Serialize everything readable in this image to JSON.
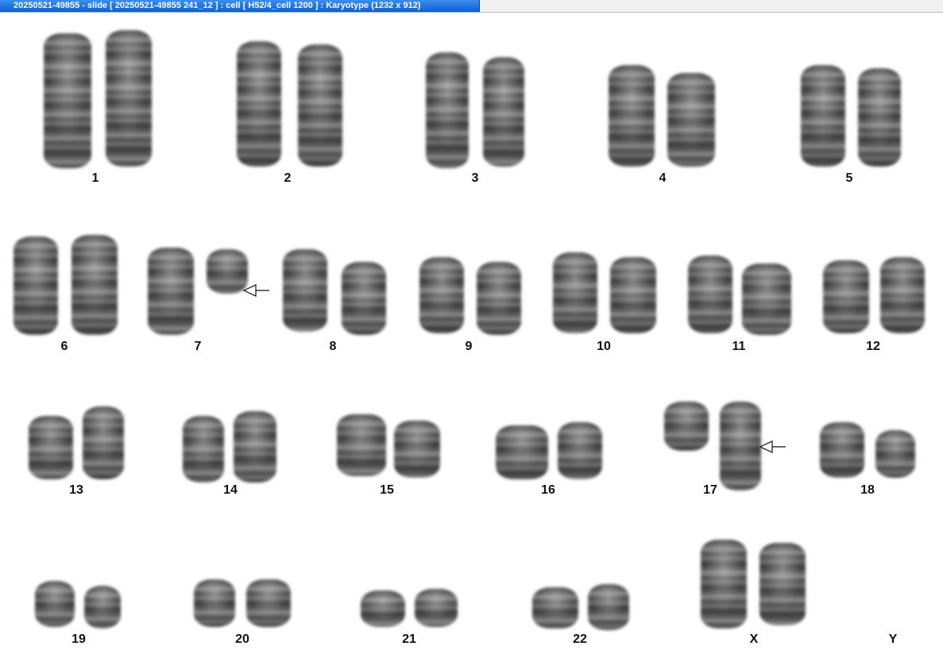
{
  "window": {
    "title": "20250521-49855 - slide [ 20250521-49855 241_12 ] : cell [ H52/4_cell 1200 ] : Karyotype  (1232 x 912)"
  },
  "colors": {
    "tab_active": "#1a6fe0",
    "background": "#ffffff",
    "label": "#111111"
  },
  "chromosomes": [
    {
      "label": "1"
    },
    {
      "label": "2"
    },
    {
      "label": "3"
    },
    {
      "label": "4"
    },
    {
      "label": "5"
    },
    {
      "label": "6"
    },
    {
      "label": "7"
    },
    {
      "label": "8"
    },
    {
      "label": "9"
    },
    {
      "label": "10"
    },
    {
      "label": "11"
    },
    {
      "label": "12"
    },
    {
      "label": "13"
    },
    {
      "label": "14"
    },
    {
      "label": "15"
    },
    {
      "label": "16"
    },
    {
      "label": "17"
    },
    {
      "label": "18"
    },
    {
      "label": "19"
    },
    {
      "label": "20"
    },
    {
      "label": "21"
    },
    {
      "label": "22"
    },
    {
      "label": "X"
    },
    {
      "label": "Y"
    }
  ],
  "markers": [
    {
      "chromosome": "7",
      "icon": "arrow-left-icon"
    },
    {
      "chromosome": "17",
      "icon": "arrow-left-icon"
    }
  ]
}
